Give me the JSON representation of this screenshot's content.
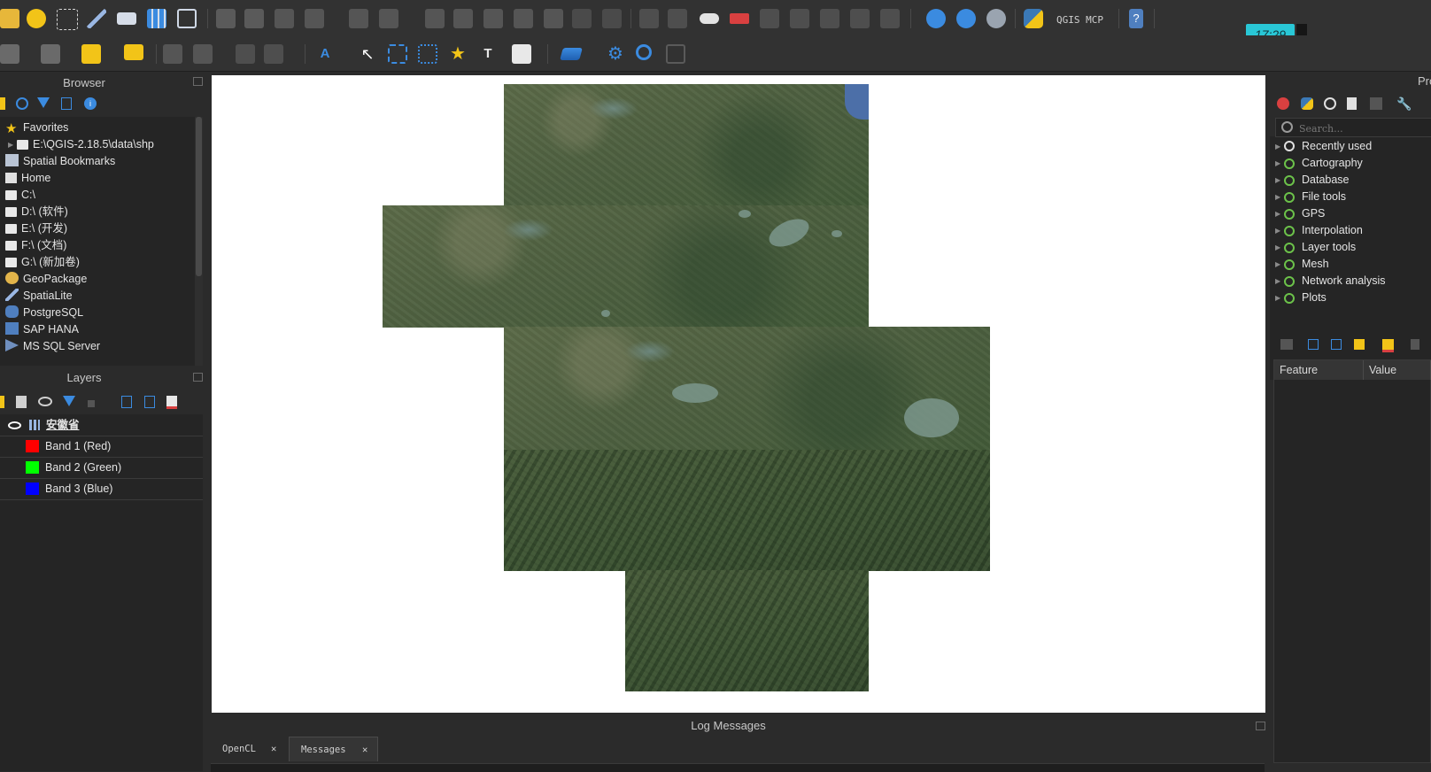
{
  "colors": {
    "panel_bg": "#2b2b2b",
    "toolbar_bg": "#323232",
    "canvas_bg": "#ffffff",
    "accent_blue": "#3b8be0",
    "accent_yellow": "#f2c418",
    "clock_bg": "#29c7d6",
    "qgis_green": "#6cc24a"
  },
  "toolbar": {
    "plugin_label": "QGIS MCP",
    "clock": "17:29"
  },
  "browser": {
    "title": "Browser",
    "items": [
      {
        "label": "Favorites",
        "icon": "star-icon"
      },
      {
        "label": "E:\\QGIS-2.18.5\\data\\shp",
        "icon": "folder-icon"
      },
      {
        "label": "Spatial Bookmarks",
        "icon": "bookmark-icon"
      },
      {
        "label": "Home",
        "icon": "home-icon"
      },
      {
        "label": "C:\\",
        "icon": "folder-icon"
      },
      {
        "label": "D:\\ (软件)",
        "icon": "folder-icon"
      },
      {
        "label": "E:\\ (开发)",
        "icon": "folder-icon"
      },
      {
        "label": "F:\\ (文档)",
        "icon": "folder-icon"
      },
      {
        "label": "G:\\ (新加卷)",
        "icon": "folder-icon"
      },
      {
        "label": "GeoPackage",
        "icon": "geopackage-icon"
      },
      {
        "label": "SpatiaLite",
        "icon": "spatialite-icon"
      },
      {
        "label": "PostgreSQL",
        "icon": "postgresql-icon"
      },
      {
        "label": "SAP HANA",
        "icon": "hana-icon"
      },
      {
        "label": "MS SQL Server",
        "icon": "mssql-icon"
      }
    ]
  },
  "layers": {
    "title": "Layers",
    "layer_name": "安徽省",
    "bands": [
      {
        "label": "Band 1 (Red)",
        "color": "#ff0000"
      },
      {
        "label": "Band 2 (Green)",
        "color": "#00ff00"
      },
      {
        "label": "Band 3 (Blue)",
        "color": "#0000ff"
      }
    ]
  },
  "processing": {
    "title": "Pro",
    "search_placeholder": "Search...",
    "items": [
      {
        "label": "Recently used",
        "icon": "clock-icon"
      },
      {
        "label": "Cartography",
        "icon": "qgis-icon"
      },
      {
        "label": "Database",
        "icon": "qgis-icon"
      },
      {
        "label": "File tools",
        "icon": "qgis-icon"
      },
      {
        "label": "GPS",
        "icon": "qgis-icon"
      },
      {
        "label": "Interpolation",
        "icon": "qgis-icon"
      },
      {
        "label": "Layer tools",
        "icon": "qgis-icon"
      },
      {
        "label": "Mesh",
        "icon": "qgis-icon"
      },
      {
        "label": "Network analysis",
        "icon": "qgis-icon"
      },
      {
        "label": "Plots",
        "icon": "qgis-icon"
      }
    ]
  },
  "identify": {
    "col_feature": "Feature",
    "col_value": "Value"
  },
  "log": {
    "title": "Log Messages",
    "tabs": [
      {
        "label": "OpenCL"
      },
      {
        "label": "Messages"
      }
    ]
  }
}
